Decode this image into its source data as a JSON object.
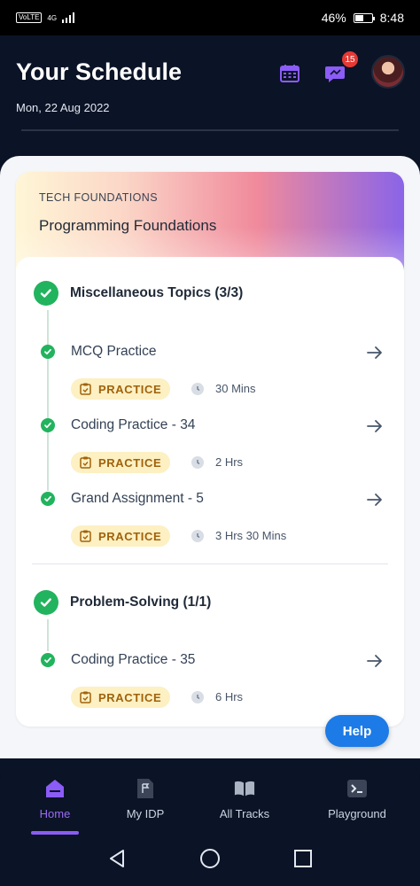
{
  "status_bar": {
    "network_badge": "VoLTE",
    "network_type": "4G",
    "battery": "46%",
    "time": "8:48"
  },
  "header": {
    "title": "Your Schedule",
    "date": "Mon, 22 Aug 2022",
    "notification_count": "15",
    "icons": [
      "calendar-icon",
      "message-icon",
      "avatar"
    ]
  },
  "course": {
    "category": "TECH FOUNDATIONS",
    "title": "Programming Foundations"
  },
  "sections": [
    {
      "title": "Miscellaneous Topics (3/3)",
      "items": [
        {
          "title": "MCQ Practice",
          "tag": "PRACTICE",
          "duration": "30 Mins"
        },
        {
          "title": "Coding Practice - 34",
          "tag": "PRACTICE",
          "duration": "2 Hrs"
        },
        {
          "title": "Grand Assignment - 5",
          "tag": "PRACTICE",
          "duration": "3 Hrs 30 Mins"
        }
      ]
    },
    {
      "title": "Problem-Solving (1/1)",
      "items": [
        {
          "title": "Coding Practice - 35",
          "tag": "PRACTICE",
          "duration": "6 Hrs"
        }
      ]
    }
  ],
  "help_label": "Help",
  "bottom_nav": [
    {
      "label": "Home",
      "icon": "home-icon",
      "active": true
    },
    {
      "label": "My IDP",
      "icon": "flag-document-icon",
      "active": false
    },
    {
      "label": "All Tracks",
      "icon": "book-icon",
      "active": false
    },
    {
      "label": "Playground",
      "icon": "terminal-icon",
      "active": false
    }
  ],
  "colors": {
    "background": "#0b1326",
    "accent": "#8b5cf6",
    "success": "#22b35e",
    "practice_tag_bg": "#fdf0c2",
    "practice_tag_text": "#a0620c",
    "help_button": "#1c7be6",
    "badge": "#e53935"
  }
}
